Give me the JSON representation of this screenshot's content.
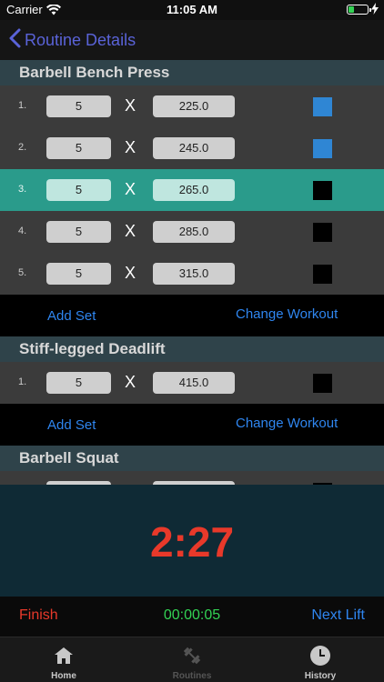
{
  "status_bar": {
    "carrier": "Carrier",
    "time": "11:05 AM",
    "wifi_icon": "wifi-icon",
    "battery_icon": "battery-icon",
    "battery_level": 0.3,
    "charge_icon": "bolt-icon"
  },
  "nav": {
    "back_label": "Routine Details",
    "back_icon": "chevron-left-icon"
  },
  "exercises": [
    {
      "name": "Barbell Bench Press",
      "sets": [
        {
          "index": "1.",
          "reps": "5",
          "times": "X",
          "weight": "225.0",
          "done": true,
          "selected": false
        },
        {
          "index": "2.",
          "reps": "5",
          "times": "X",
          "weight": "245.0",
          "done": true,
          "selected": false
        },
        {
          "index": "3.",
          "reps": "5",
          "times": "X",
          "weight": "265.0",
          "done": false,
          "selected": true
        },
        {
          "index": "4.",
          "reps": "5",
          "times": "X",
          "weight": "285.0",
          "done": false,
          "selected": false
        },
        {
          "index": "5.",
          "reps": "5",
          "times": "X",
          "weight": "315.0",
          "done": false,
          "selected": false
        }
      ],
      "add_set_label": "Add Set",
      "change_workout_label": "Change Workout"
    },
    {
      "name": "Stiff-legged Deadlift",
      "sets": [
        {
          "index": "1.",
          "reps": "5",
          "times": "X",
          "weight": "415.0",
          "done": false,
          "selected": false
        }
      ],
      "add_set_label": "Add Set",
      "change_workout_label": "Change Workout"
    },
    {
      "name": "Barbell Squat",
      "sets": [
        {
          "index": "",
          "reps": "",
          "times": "",
          "weight": "",
          "done": false,
          "selected": false
        }
      ]
    }
  ],
  "timer": {
    "countdown": "2:27"
  },
  "controls": {
    "finish_label": "Finish",
    "elapsed": "00:00:05",
    "next_lift_label": "Next Lift"
  },
  "tabs": [
    {
      "label": "Home",
      "icon": "home-icon",
      "enabled": true
    },
    {
      "label": "Routines",
      "icon": "dumbbell-icon",
      "enabled": false
    },
    {
      "label": "History",
      "icon": "clock-icon",
      "enabled": true
    }
  ],
  "colors": {
    "accent_blue": "#2f86f0",
    "back_purple": "#5a63d8",
    "selected_row": "#2a9b8b",
    "done_checkbox": "#2f86d4",
    "timer_red": "#e8392a",
    "elapsed_green": "#33d254",
    "section_header": "#2f434a",
    "timer_panel": "#0f2a35"
  }
}
